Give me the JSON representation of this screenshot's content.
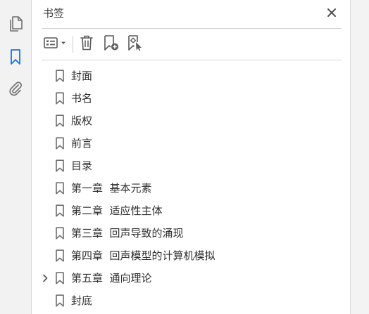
{
  "panel": {
    "title": "书签"
  },
  "rail": {
    "items": [
      {
        "name": "pages-icon",
        "active": false
      },
      {
        "name": "bookmark-icon",
        "active": true
      },
      {
        "name": "attachment-icon",
        "active": false
      }
    ]
  },
  "toolbar": {
    "buttons": [
      "options-menu-icon",
      "delete-icon",
      "new-bookmark-icon",
      "new-bookmark-from-structure-icon"
    ]
  },
  "bookmarks": [
    {
      "label": "封面",
      "expandable": false
    },
    {
      "label": "书名",
      "expandable": false
    },
    {
      "label": "版权",
      "expandable": false
    },
    {
      "label": "前言",
      "expandable": false
    },
    {
      "label": "目录",
      "expandable": false
    },
    {
      "label": "第一章  基本元素",
      "expandable": false
    },
    {
      "label": "第二章  适应性主体",
      "expandable": false
    },
    {
      "label": "第三章  回声导致的涌现",
      "expandable": false
    },
    {
      "label": "第四章  回声模型的计算机模拟",
      "expandable": false
    },
    {
      "label": "第五章  通向理论",
      "expandable": true
    },
    {
      "label": "封底",
      "expandable": false
    }
  ],
  "colors": {
    "accent": "#1473e6",
    "icon": "#6e6e6e",
    "text": "#2e2e2e"
  }
}
